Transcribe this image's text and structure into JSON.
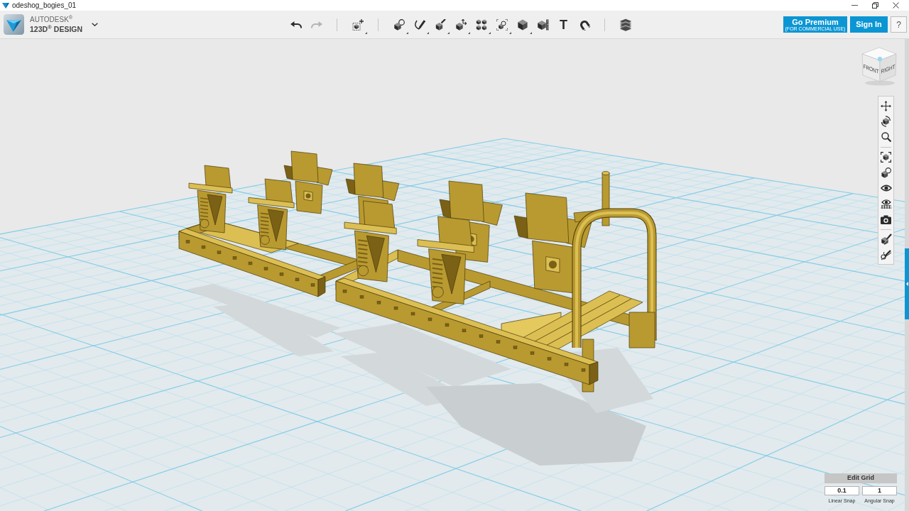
{
  "window": {
    "title": "odeshog_bogies_01"
  },
  "brand": {
    "company": "AUTODESK$^{®}$",
    "product": "123D$^{®}$ DESIGN"
  },
  "toolbar": {
    "groups": [
      {
        "items": [
          {
            "kind": "undo",
            "disabled": false,
            "menu": false
          },
          {
            "kind": "redo",
            "disabled": true,
            "menu": false
          }
        ]
      },
      {
        "items": [
          {
            "kind": "transform",
            "disabled": false,
            "menu": true
          }
        ]
      },
      {
        "items": [
          {
            "kind": "primitives",
            "disabled": false,
            "menu": true
          },
          {
            "kind": "sketch",
            "disabled": false,
            "menu": true
          },
          {
            "kind": "construct",
            "disabled": false,
            "menu": true
          },
          {
            "kind": "modify",
            "disabled": false,
            "menu": true
          },
          {
            "kind": "pattern",
            "disabled": false,
            "menu": true
          },
          {
            "kind": "group",
            "disabled": false,
            "menu": true
          },
          {
            "kind": "combine",
            "disabled": false,
            "menu": true
          },
          {
            "kind": "measure",
            "disabled": false,
            "menu": false
          },
          {
            "kind": "text",
            "glyph": "T",
            "disabled": false,
            "menu": false
          },
          {
            "kind": "snap",
            "disabled": false,
            "menu": false
          }
        ]
      },
      {
        "items": [
          {
            "kind": "materials",
            "disabled": false,
            "menu": false
          }
        ]
      }
    ]
  },
  "account": {
    "premium_label": "Go Premium",
    "premium_note": "(FOR COMMERCIAL USE)",
    "sign_in": "Sign In",
    "help": "?"
  },
  "view_cube": {
    "front": "FRONT",
    "right": "RIGHT"
  },
  "navigation": {
    "groups": [
      {
        "items": [
          {
            "kind": "pan"
          },
          {
            "kind": "orbit"
          },
          {
            "kind": "zoom"
          }
        ]
      },
      {
        "items": [
          {
            "kind": "fit"
          },
          {
            "kind": "shading"
          },
          {
            "kind": "visibility"
          },
          {
            "kind": "grid"
          },
          {
            "kind": "camera"
          }
        ]
      },
      {
        "items": [
          {
            "kind": "material"
          },
          {
            "kind": "sketch"
          }
        ]
      }
    ]
  },
  "edit_grid": {
    "title": "Edit Grid",
    "fields": [
      {
        "value": "0.1",
        "label": "Linear Snap"
      },
      {
        "value": "1",
        "label": "Angular Snap"
      }
    ]
  }
}
